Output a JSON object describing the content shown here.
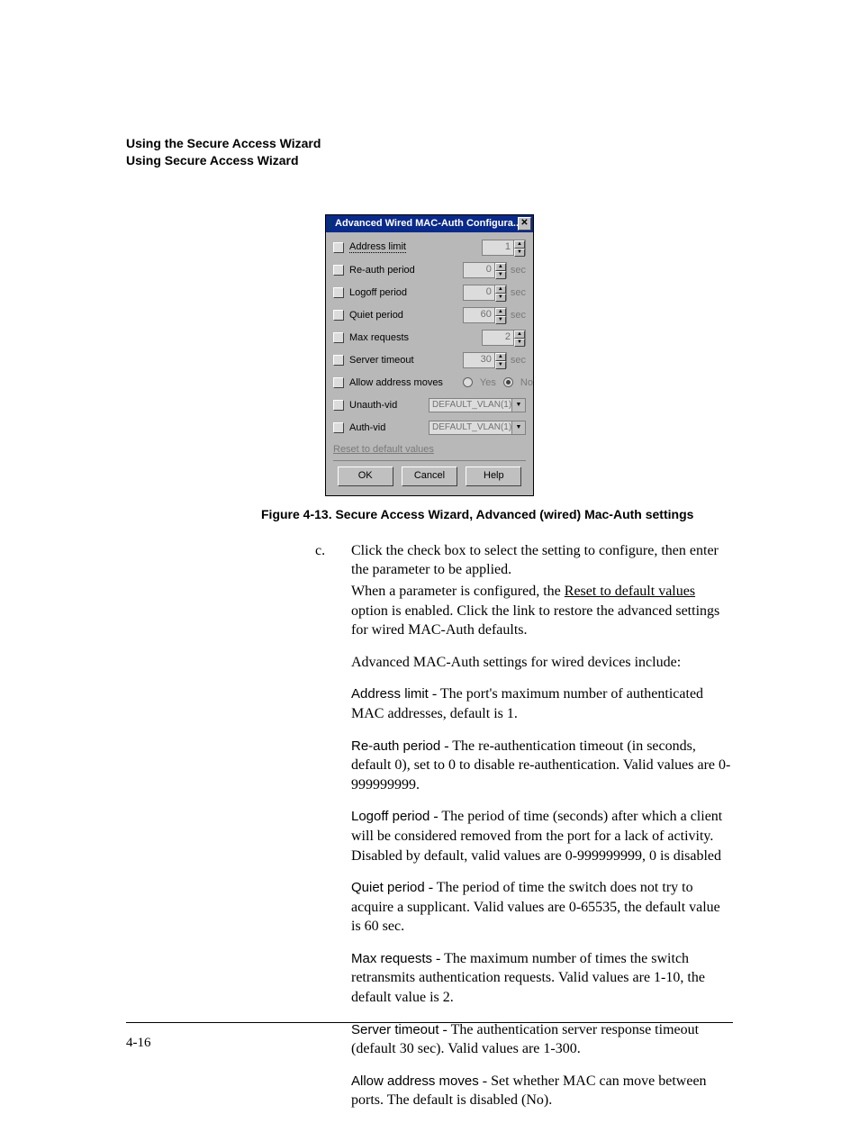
{
  "header": {
    "line1": "Using the Secure Access Wizard",
    "line2": "Using Secure Access Wizard"
  },
  "dialog": {
    "title": "Advanced Wired MAC-Auth Configura...",
    "close_glyph": "✕",
    "rows": {
      "address_limit": {
        "label": "Address limit",
        "value": "1"
      },
      "reauth": {
        "label": "Re-auth period",
        "value": "0",
        "unit": "sec"
      },
      "logoff": {
        "label": "Logoff period",
        "value": "0",
        "unit": "sec"
      },
      "quiet": {
        "label": "Quiet period",
        "value": "60",
        "unit": "sec"
      },
      "maxreq": {
        "label": "Max requests",
        "value": "2"
      },
      "srvtimeout": {
        "label": "Server timeout",
        "value": "30",
        "unit": "sec"
      },
      "allowmoves": {
        "label": "Allow address moves",
        "yes": "Yes",
        "no": "No"
      },
      "unauth": {
        "label": "Unauth-vid",
        "value": "DEFAULT_VLAN(1)"
      },
      "auth": {
        "label": "Auth-vid",
        "value": "DEFAULT_VLAN(1)"
      }
    },
    "reset_link": "Reset to default values",
    "buttons": {
      "ok": "OK",
      "cancel": "Cancel",
      "help": "Help"
    }
  },
  "caption": "Figure 4-13. Secure Access Wizard, Advanced (wired) Mac-Auth settings",
  "step": {
    "marker": "c.",
    "p1": "Click the check box to select the setting to configure, then enter the parameter to be applied.",
    "p2a": "When a parameter is configured, the ",
    "p2_link": "Reset to default values",
    "p2b": " option is enabled. Click the link to restore the advanced settings for wired MAC-Auth defaults.",
    "p3": "Advanced MAC-Auth settings for wired devices include:"
  },
  "defs": {
    "addr": {
      "term": "Address limit",
      "sep": " - ",
      "text": "The port's maximum number of authenticated MAC addresses, default is 1."
    },
    "reauth": {
      "term": "Re-auth period",
      "sep": " - ",
      "text": "The re-authentication timeout (in seconds, default 0), set to 0 to disable re-authentication. Valid values are 0-999999999."
    },
    "logoff": {
      "term": "Logoff period",
      "sep": " - ",
      "text": "The period of time (seconds) after which a client will be considered removed from the port for a lack of activity. Disabled by default, valid values are 0-999999999, 0 is disabled"
    },
    "quiet": {
      "term": "Quiet period",
      "sep": " - ",
      "text": "The period of time the switch does not try to acquire a supplicant. Valid values are 0-65535, the default value is 60 sec."
    },
    "maxreq": {
      "term": "Max requests",
      "sep": " - ",
      "text": "The maximum number of times the switch retransmits authentication requests. Valid values are 1-10, the default value is 2."
    },
    "srvto": {
      "term": "Server timeout",
      "sep": " - ",
      "text": "The authentication server response timeout (default 30 sec). Valid values are 1-300."
    },
    "allow": {
      "term": "Allow address moves",
      "sep": " - ",
      "text": "Set whether MAC can move between ports. The default is disabled (No)."
    }
  },
  "page_number": "4-16"
}
